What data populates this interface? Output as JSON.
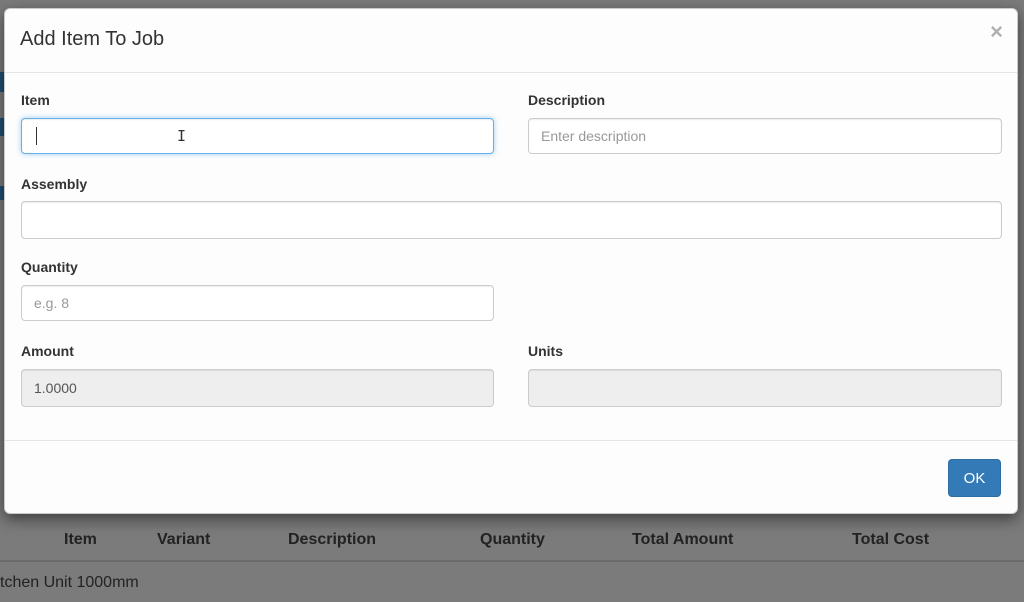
{
  "modal": {
    "title": "Add Item To Job",
    "close_icon": "close-icon",
    "fields": {
      "item": {
        "label": "Item",
        "value": "",
        "placeholder": ""
      },
      "description": {
        "label": "Description",
        "value": "",
        "placeholder": "Enter description"
      },
      "assembly": {
        "label": "Assembly",
        "value": "",
        "placeholder": ""
      },
      "quantity": {
        "label": "Quantity",
        "value": "",
        "placeholder": "e.g. 8"
      },
      "amount": {
        "label": "Amount",
        "value": "1.0000"
      },
      "units": {
        "label": "Units",
        "value": ""
      }
    },
    "ok_label": "OK"
  },
  "background_table": {
    "headers": [
      "Item",
      "Variant",
      "Description",
      "Quantity",
      "Total Amount",
      "Total Cost"
    ],
    "rows": [
      {
        "item": "tchen Unit 1000mm"
      }
    ]
  },
  "colors": {
    "primary": "#337ab7",
    "focus_border": "#66afe9",
    "backdrop": "#7b7b7b"
  }
}
